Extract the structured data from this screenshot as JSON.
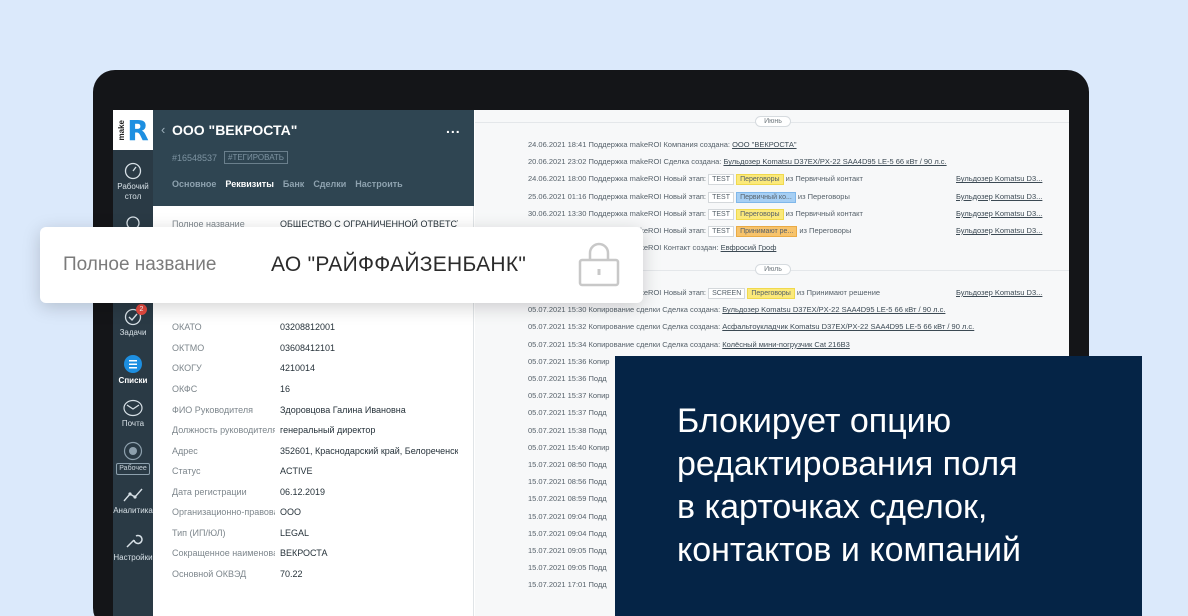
{
  "company": {
    "title": "ООО \"ВЕКРОСТА\"",
    "id": "#16548537",
    "tag_button": "#ТЕГИРОВАТЬ",
    "menu": "..."
  },
  "tabs": [
    "Основное",
    "Реквизиты",
    "Банк",
    "Сделки",
    "Настроить"
  ],
  "rail": {
    "logo_small": "make",
    "logo_big": "R",
    "items": [
      {
        "label": "Рабочий стол"
      },
      {
        "label": "Задачи",
        "badge": "2"
      },
      {
        "label": "Списки"
      },
      {
        "label": "Почта"
      },
      {
        "label": "Рабочее"
      },
      {
        "label": "Аналитика"
      },
      {
        "label": "Настройки"
      }
    ]
  },
  "fields": [
    {
      "label": "Полное название",
      "value": "ОБЩЕСТВО С ОГРАНИЧЕННОЙ ОТВЕТСТВЕ"
    },
    {
      "label": "ОКАТО",
      "value": "03208812001"
    },
    {
      "label": "ОКТМО",
      "value": "03608412101"
    },
    {
      "label": "ОКОГУ",
      "value": "4210014"
    },
    {
      "label": "ОКФС",
      "value": "16"
    },
    {
      "label": "ФИО Руководителя",
      "value": "Здоровцова Галина Ивановна"
    },
    {
      "label": "Должность руководителя",
      "value": "генеральный директор"
    },
    {
      "label": "Адрес",
      "value": "352601, Краснодарский край, Белореченск"
    },
    {
      "label": "Статус",
      "value": "ACTIVE"
    },
    {
      "label": "Дата регистрации",
      "value": "06.12.2019"
    },
    {
      "label": "Организационно-правовая форма",
      "value": "ООО"
    },
    {
      "label": "Тип (ИП/ЮЛ)",
      "value": "LEGAL"
    },
    {
      "label": "Сокращенное наименование",
      "value": "ВЕКРОСТА"
    },
    {
      "label": "Основной ОКВЭД",
      "value": "70.22"
    }
  ],
  "floating_field": {
    "label": "Полное название",
    "value": "АО \"РАЙФФАЙЗЕНБАНК\""
  },
  "feed": {
    "month1": "Июнь",
    "month2": "Июль",
    "events_june": [
      {
        "text": "24.06.2021 18:41 Поддержка makeROI Компания создана: ",
        "link": "ООО \"ВЕКРОСТА\""
      },
      {
        "text": "20.06.2021 23:02 Поддержка makeROI Сделка создана: ",
        "link": "Бульдозер Komatsu D37EX/PX-22 SAA4D95 LE-5 66 кВт / 90 л.с."
      },
      {
        "text": "24.06.2021 18:00 Поддержка makeROI Новый этап: ",
        "chip1": "TEST",
        "chip2": "Переговоры",
        "c2": "y",
        "tail": " из Первичный контакт",
        "right": "Бульдозер Komatsu D3..."
      },
      {
        "text": "25.06.2021 01:16 Поддержка makeROI Новый этап: ",
        "chip1": "TEST",
        "chip2": "Первичный ко...",
        "c2": "b",
        "tail": " из Переговоры",
        "right": "Бульдозер Komatsu D3..."
      },
      {
        "text": "30.06.2021 13:30 Поддержка makeROI Новый этап: ",
        "chip1": "TEST",
        "chip2": "Переговоры",
        "c2": "y",
        "tail": " из Первичный контакт",
        "right": "Бульдозер Komatsu D3..."
      },
      {
        "text": "30.06.2021 13:31 Поддержка makeROI Новый этап: ",
        "chip1": "TEST",
        "chip2": "Принимают ре...",
        "c2": "o",
        "tail": " из Переговоры",
        "right": "Бульдозер Komatsu D3..."
      },
      {
        "text": "30.06.2021 13:35 Поддержка makeROI Контакт создан: ",
        "link": "Евфросий Гроф"
      }
    ],
    "events_july": [
      {
        "text": "05.07.2021 15:29 Поддержка makeROI Новый этап: ",
        "chip1": "SCREEN",
        "chip2": "Переговоры",
        "c2": "y",
        "tail": " из Принимают решение",
        "right": "Бульдозер Komatsu D3..."
      },
      {
        "text": "05.07.2021 15:30 Копирование сделки Сделка создана: ",
        "link": "Бульдозер Komatsu D37EX/PX-22 SAA4D95 LE-5 66 кВт / 90 л.с."
      },
      {
        "text": "05.07.2021 15:32 Копирование сделки Сделка создана: ",
        "link": "Асфальтоукладчик Komatsu D37EX/PX-22 SAA4D95 LE-5 66 кВт / 90 л.с."
      },
      {
        "text": "05.07.2021 15:34 Копирование сделки Сделка создана: ",
        "link": "Колёсный мини-погрузчик Cat 216B3"
      },
      {
        "text": "05.07.2021 15:36 Копир"
      },
      {
        "text": "05.07.2021 15:36 Подд"
      },
      {
        "text": "05.07.2021 15:37 Копир"
      },
      {
        "text": "05.07.2021 15:37 Подд"
      },
      {
        "text": "05.07.2021 15:38 Подд"
      },
      {
        "text": "05.07.2021 15:40 Копир"
      },
      {
        "text": "15.07.2021 08:50 Подд"
      },
      {
        "text": "15.07.2021 08:56 Подд"
      },
      {
        "text": "15.07.2021 08:59 Подд"
      },
      {
        "text": "15.07.2021 09:04 Подд"
      },
      {
        "text": "15.07.2021 09:04 Подд"
      },
      {
        "text": "15.07.2021 09:05 Подд"
      },
      {
        "text": "15.07.2021 09:05 Подд"
      },
      {
        "text": "15.07.2021 17:01 Подд"
      }
    ]
  },
  "promo": {
    "lines": [
      "Блокирует опцию",
      "редактирования поля",
      "в карточках сделок,",
      "контактов и компаний"
    ]
  },
  "colors": {
    "background": "#dbe9fb",
    "promo": "#052446",
    "panel_header": "#2f4552",
    "rail": "#2a3a45",
    "accent": "#1d8fe1"
  }
}
